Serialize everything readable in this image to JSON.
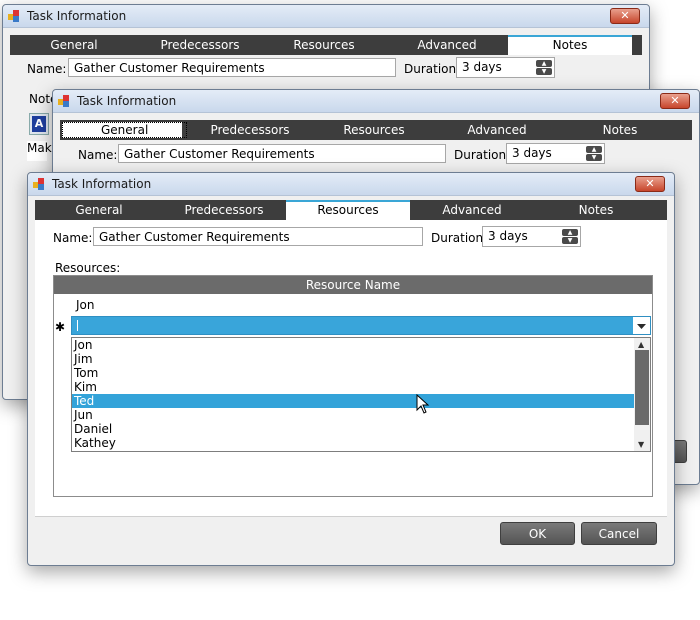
{
  "title": "Task Information",
  "close_glyph": "✕",
  "tabs": [
    "General",
    "Predecessors",
    "Resources",
    "Advanced",
    "Notes"
  ],
  "name_label": "Name:",
  "name_value": "Gather Customer Requirements",
  "duration_label": "Duration:",
  "duration_value": "3 days",
  "back_window": {
    "notes_label": "Note",
    "toolbar_letter": "A",
    "editor_text": "Mak"
  },
  "resources": {
    "label": "Resources:",
    "column_header": "Resource Name",
    "rows": [
      "Jon"
    ],
    "new_row_glyph": "✱",
    "dropdown_options": [
      "Jon",
      "Jim",
      "Tom",
      "Kim",
      "Ted",
      "Jun",
      "Daniel",
      "Kathey"
    ],
    "highlighted_option": "Ted"
  },
  "buttons": {
    "ok": "OK",
    "cancel": "Cancel"
  },
  "colors": {
    "tab_strip": "#3d3d3d",
    "accent": "#33a3d9",
    "close": "#c7452b"
  },
  "icons": {
    "app": "app-icon",
    "close": "close-icon",
    "cursor": "mouse-pointer-icon",
    "spin": "spinner-arrows-icon"
  }
}
